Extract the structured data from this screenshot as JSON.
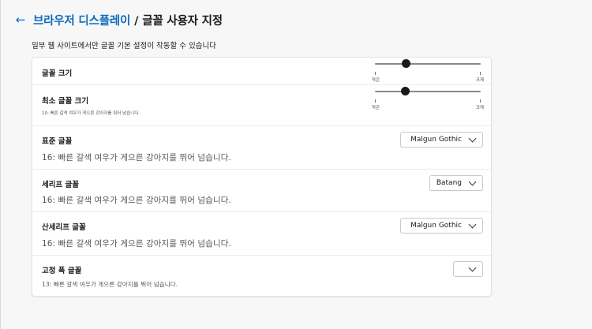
{
  "header": {
    "back_icon": "arrow-left-icon",
    "breadcrumb_parent": "브라우저 디스플레이",
    "separator": "/",
    "page_title": "글꼴 사용자 지정"
  },
  "subtitle": "일부 웹 사이트에서만 글꼴 기본 설정이 작동할 수 있습니다",
  "font_size": {
    "label": "글꼴 크기",
    "slider_value_fraction": 0.29,
    "min_label": "작은",
    "max_label": "크게"
  },
  "min_font_size": {
    "label": "최소 글꼴 크기",
    "sample": "10: 빠른 갈색 여우가 게으른 강아지를 뛰어 넘습니다.",
    "slider_value_fraction": 0.28,
    "min_label": "작은",
    "max_label": "크게"
  },
  "standard_font": {
    "label": "표준 글꼴",
    "sample": "16: 빠른 갈색 여우가 게으른 강아지를 뛰어 넘습니다.",
    "selected": "Malgun Gothic"
  },
  "serif_font": {
    "label": "세리프 글꼴",
    "sample": "16: 빠른 갈색 여우가 게으른 강아지를 뛰어 넘습니다.",
    "selected": "Batang"
  },
  "sans_serif_font": {
    "label": "산세리프 글꼴",
    "sample": "16: 빠른 갈색 여우가 게으른 강아지를 뛰어 넘습니다.",
    "selected": "Malgun Gothic"
  },
  "fixed_width_font": {
    "label": "고정 폭 글꼴",
    "sample": "13: 빠른 갈색 여우가 게으른 강아지를 뛰어 넘습니다.",
    "selected": ""
  },
  "colors": {
    "accent": "#0f6cbd",
    "text": "#1a1a1a",
    "muted": "#555555"
  }
}
